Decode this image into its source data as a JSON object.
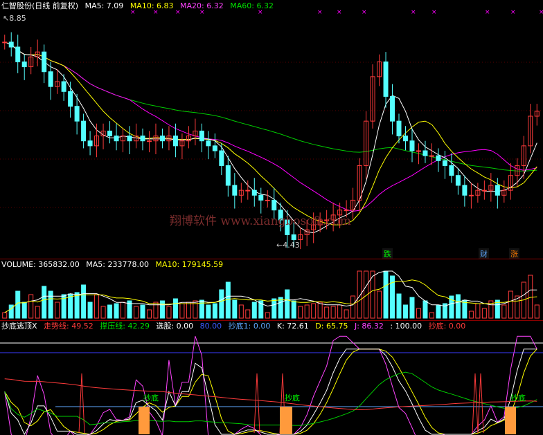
{
  "price_panel": {
    "stock": "仁智股份(日线 前复权)",
    "ma5": "MA5: 7.09",
    "ma10": "MA10: 6.83",
    "ma20": "MA20: 6.32",
    "ma60": "MA60: 6.32",
    "high_label": "8.85",
    "low_label": "4.43",
    "watermark": "翔博软件 www.xiangbosoft.com",
    "tags": [
      "跌",
      "财",
      "涨"
    ]
  },
  "volume_panel": {
    "volume": "VOLUME: 365832.00",
    "ma5": "MA5: 233778.00",
    "ma10": "MA10: 179145.59"
  },
  "indicator_panel": {
    "name": "抄底逃顶X",
    "trend": "走势线: 49.52",
    "support": "撑压线: 42.29",
    "select": "选股: 0.00",
    "level80": "80.00",
    "chaodi1": "抄底1: 0.00",
    "k": "K: 72.61",
    "d": "D: 65.75",
    "j": "J: 86.32",
    "level100": ": 100.00",
    "chaodi": "抄底: 0.00",
    "buy_label": "抄底"
  },
  "colors": {
    "bg": "#000000",
    "up": "#ff3b3b",
    "down": "#54ffff",
    "ma5": "#ffffff",
    "ma10": "#ffff00",
    "ma20": "#ff00ff",
    "ma60": "#00cc00",
    "signal": "#ff9a3c",
    "separator": "#8b0000"
  },
  "chart_data": {
    "type": "candlestick",
    "close_path": [
      8.5,
      8.4,
      8.1,
      8.0,
      8.2,
      8.3,
      7.9,
      7.6,
      7.7,
      7.5,
      7.2,
      6.9,
      6.5,
      6.4,
      6.6,
      6.7,
      6.6,
      6.5,
      6.6,
      6.5,
      6.6,
      6.5,
      6.5,
      6.6,
      6.5,
      6.6,
      6.4,
      6.5,
      6.6,
      6.7,
      6.5,
      6.4,
      6.3,
      6.0,
      5.6,
      5.4,
      5.5,
      5.5,
      5.4,
      5.3,
      5.3,
      5.1,
      4.9,
      4.6,
      4.5,
      4.6,
      4.7,
      4.8,
      4.9,
      4.9,
      5.0,
      5.1,
      5.1,
      5.3,
      6.0,
      6.9,
      7.8,
      8.1,
      7.4,
      6.9,
      6.6,
      6.5,
      6.3,
      6.3,
      6.2,
      6.2,
      6.1,
      6.0,
      5.8,
      5.6,
      5.4,
      5.4,
      5.5,
      5.5,
      5.6,
      5.4,
      5.5,
      5.8,
      6.0,
      6.4,
      7.0,
      7.1
    ],
    "price_range": [
      4.2,
      9.1
    ],
    "labels": {
      "high": 8.85,
      "low": 4.43
    },
    "series": [
      "MA5",
      "MA10",
      "MA20",
      "MA60"
    ]
  }
}
